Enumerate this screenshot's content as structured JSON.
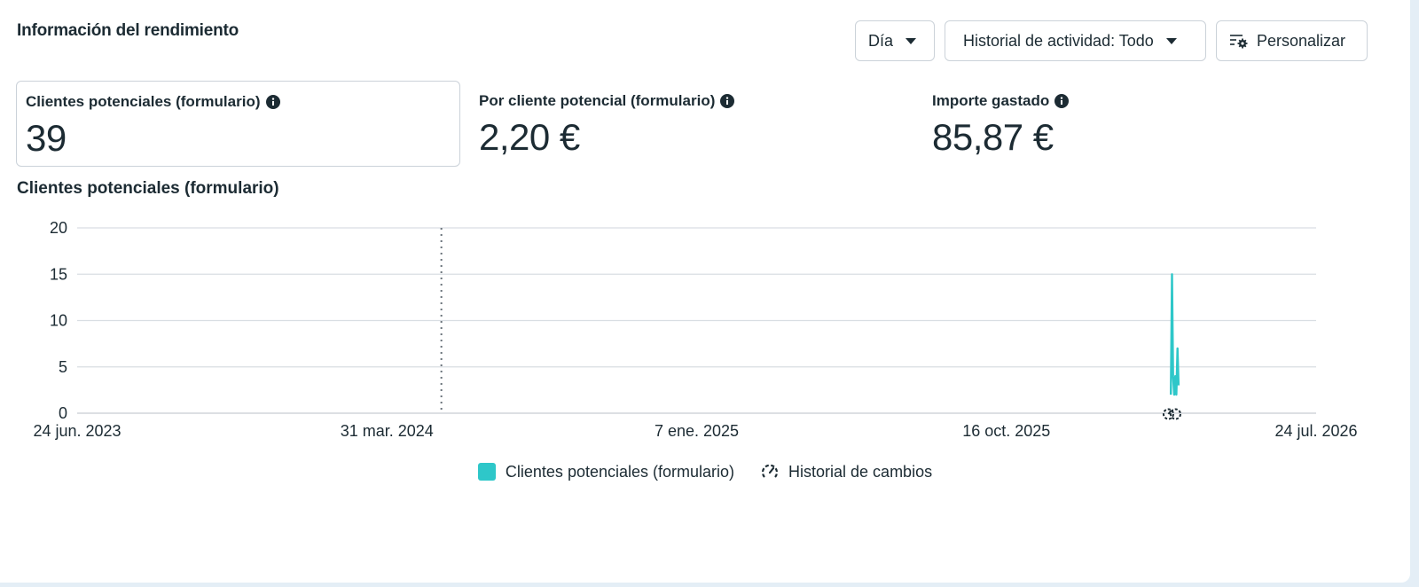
{
  "header": {
    "title": "Información del rendimiento",
    "day_button": "Día",
    "activity_button": "Historial de actividad: Todo",
    "customize_button": "Personalizar"
  },
  "metrics": [
    {
      "label": "Clientes potenciales (formulario)",
      "value": "39"
    },
    {
      "label": "Por cliente potencial (formulario)",
      "value": "2,20 €"
    },
    {
      "label": "Importe gastado",
      "value": "85,87 €"
    }
  ],
  "chart_title": "Clientes potenciales (formulario)",
  "legend": {
    "series_label": "Clientes potenciales (formulario)",
    "changes_label": "Historial de cambios"
  },
  "colors": {
    "series": "#2ec7c9",
    "grid": "#d9dee3",
    "text": "#1c2b33"
  },
  "chart_data": {
    "type": "line",
    "title": "",
    "xlabel": "",
    "ylabel": "",
    "ylim": [
      0,
      20
    ],
    "yticks": [
      0,
      5,
      10,
      15,
      20
    ],
    "x_ticks": [
      "24 jun. 2023",
      "31 mar. 2024",
      "7 ene. 2025",
      "16 oct. 2025",
      "24 jul. 2026"
    ],
    "xlim": [
      "2023-06-24",
      "2026-07-24"
    ],
    "reference_line": "2024-05-20",
    "change_marker": "2026-03-15",
    "series": [
      {
        "name": "Clientes potenciales (formulario)",
        "points": [
          {
            "x": "2026-03-14",
            "y": 2
          },
          {
            "x": "2026-03-15",
            "y": 15
          },
          {
            "x": "2026-03-16",
            "y": 4
          },
          {
            "x": "2026-03-17",
            "y": 2
          },
          {
            "x": "2026-03-18",
            "y": 4
          },
          {
            "x": "2026-03-19",
            "y": 2
          },
          {
            "x": "2026-03-20",
            "y": 7
          },
          {
            "x": "2026-03-21",
            "y": 3
          }
        ]
      }
    ],
    "legend_position": "bottom-center",
    "grid": true
  }
}
